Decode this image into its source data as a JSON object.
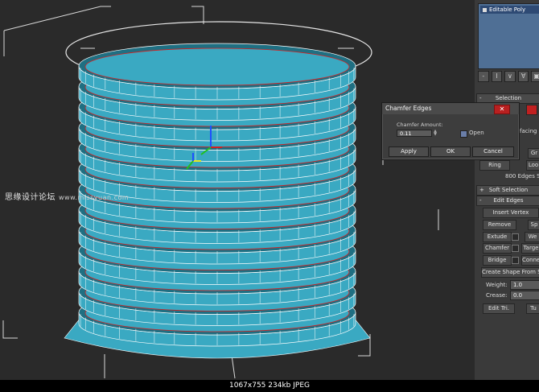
{
  "watermark": {
    "text": "思缘设计论坛",
    "url": "www.missyuan.com"
  },
  "modifier_stack": {
    "item": "Editable Poly",
    "tools": [
      "-",
      "I",
      "∨",
      "∀",
      "▣"
    ]
  },
  "rollouts": {
    "selection": "Selection",
    "soft_selection": "Soft Selection",
    "edit_edges": "Edit Edges"
  },
  "panel": {
    "facing_label": "kfacing",
    "grow_label": "Gr",
    "ring_label": "Ring",
    "loop_label": "Loo",
    "edges_selected": "800 Edges Se",
    "insert_vertex": "Insert Vertex",
    "remove": "Remove",
    "split": "Sp",
    "extrude": "Extude",
    "weld": "We",
    "chamfer": "Chamfer",
    "target": "Targe",
    "bridge": "Bridge",
    "connect": "Conne",
    "create_shape": "Create Shape From Se",
    "weight_label": "Weight:",
    "weight_value": "1.0",
    "crease_label": "Crease:",
    "crease_value": "0.0",
    "edit_tri": "Edit Tri.",
    "turn": "Tu"
  },
  "dialog": {
    "title": "Chamfer Edges",
    "amount_label": "Chamfer Amount:",
    "amount_value": "0.11",
    "open_label": "Open",
    "apply": "Apply",
    "ok": "OK",
    "cancel": "Cancel"
  },
  "status": "1067x755 234kb JPEG",
  "colors": {
    "mesh": "#3aa9c2",
    "mesh_dark": "#1f6f82",
    "wire": "#ffffff",
    "selected_edge": "#d62020",
    "close_button": "#b92020"
  }
}
